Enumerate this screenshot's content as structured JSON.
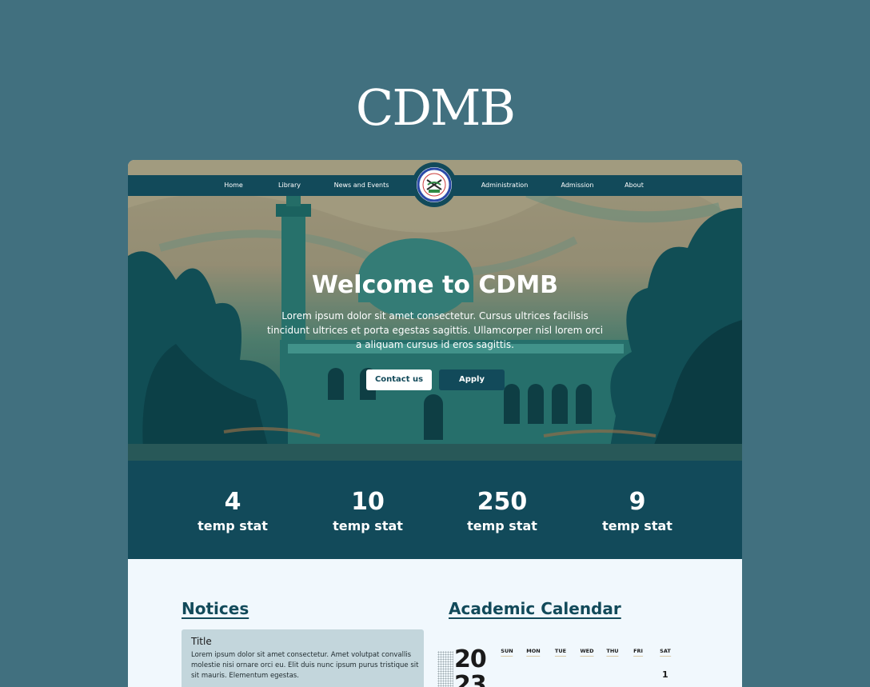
{
  "brand": {
    "title": "CDMB"
  },
  "nav": {
    "items": [
      "Home",
      "Library",
      "News and Events",
      "Administration",
      "Admission",
      "About"
    ]
  },
  "hero": {
    "title": "Welcome to CDMB",
    "text": "Lorem ipsum dolor sit amet consectetur. Cursus ultrices facilisis tincidunt ultrices et porta egestas sagittis. Ullamcorper nisl lorem orci a aliquam cursus id eros sagittis.",
    "contact_label": "Contact us",
    "apply_label": "Apply"
  },
  "stats": [
    {
      "value": "4",
      "label": "temp stat"
    },
    {
      "value": "10",
      "label": "temp stat"
    },
    {
      "value": "250",
      "label": "temp stat"
    },
    {
      "value": "9",
      "label": "temp stat"
    }
  ],
  "notices": {
    "heading": "Notices",
    "items": [
      {
        "title": "Title",
        "body": "Lorem ipsum dolor sit amet consectetur. Amet volutpat convallis molestie nisi ornare orci eu. Elit duis nunc ipsum purus tristique sit sit mauris. Elementum egestas."
      }
    ]
  },
  "calendar": {
    "heading": "Academic Calendar",
    "year_top": "20",
    "year_bottom": "23",
    "days": [
      "SUN",
      "MON",
      "TUE",
      "WED",
      "THU",
      "FRI",
      "SAT"
    ],
    "first_date": "1"
  },
  "colors": {
    "page_bg": "#41707f",
    "primary": "#124a5a",
    "section_bg": "#f1f8fd",
    "notice_card": "#c3d6dc"
  }
}
